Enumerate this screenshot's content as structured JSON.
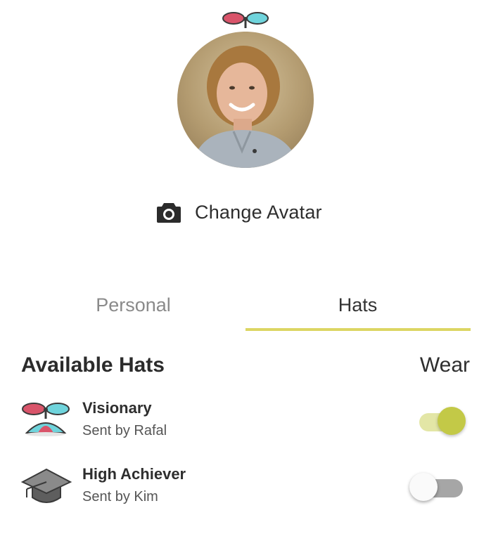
{
  "profile": {
    "avatar_icon": "user-photo",
    "worn_hat_icon": "propeller-hat-icon",
    "change_avatar": {
      "icon": "camera-icon",
      "label": "Change Avatar"
    }
  },
  "tabs": [
    {
      "label": "Personal",
      "selected": false
    },
    {
      "label": "Hats",
      "selected": true
    }
  ],
  "hats_section": {
    "title": "Available Hats",
    "wear_header": "Wear",
    "items": [
      {
        "name": "Visionary",
        "sender": "Sent by Rafal",
        "icon": "propeller-hat-icon",
        "wearing": true
      },
      {
        "name": "High Achiever",
        "sender": "Sent by Kim",
        "icon": "graduation-cap-icon",
        "wearing": false
      }
    ]
  },
  "colors": {
    "accent": "#dcd663",
    "toggle_on_knob": "#c3c947",
    "toggle_on_track": "#e3e6a6",
    "toggle_off_track": "#a6a6a6"
  }
}
